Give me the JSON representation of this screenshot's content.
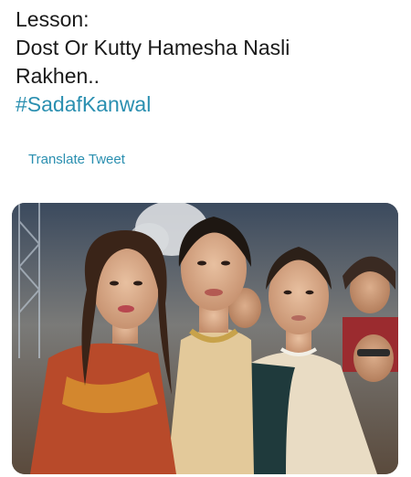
{
  "tweet": {
    "lines": [
      "Lesson:",
      "Dost Or Kutty Hamesha Nasli",
      "Rakhen.."
    ],
    "hashtag": "#SadafKanwal",
    "translate_label": "Translate Tweet"
  },
  "media": {
    "alt": "photo"
  },
  "colors": {
    "text": "#1a1a1a",
    "link": "#2a8fb0",
    "background": "#ffffff"
  }
}
